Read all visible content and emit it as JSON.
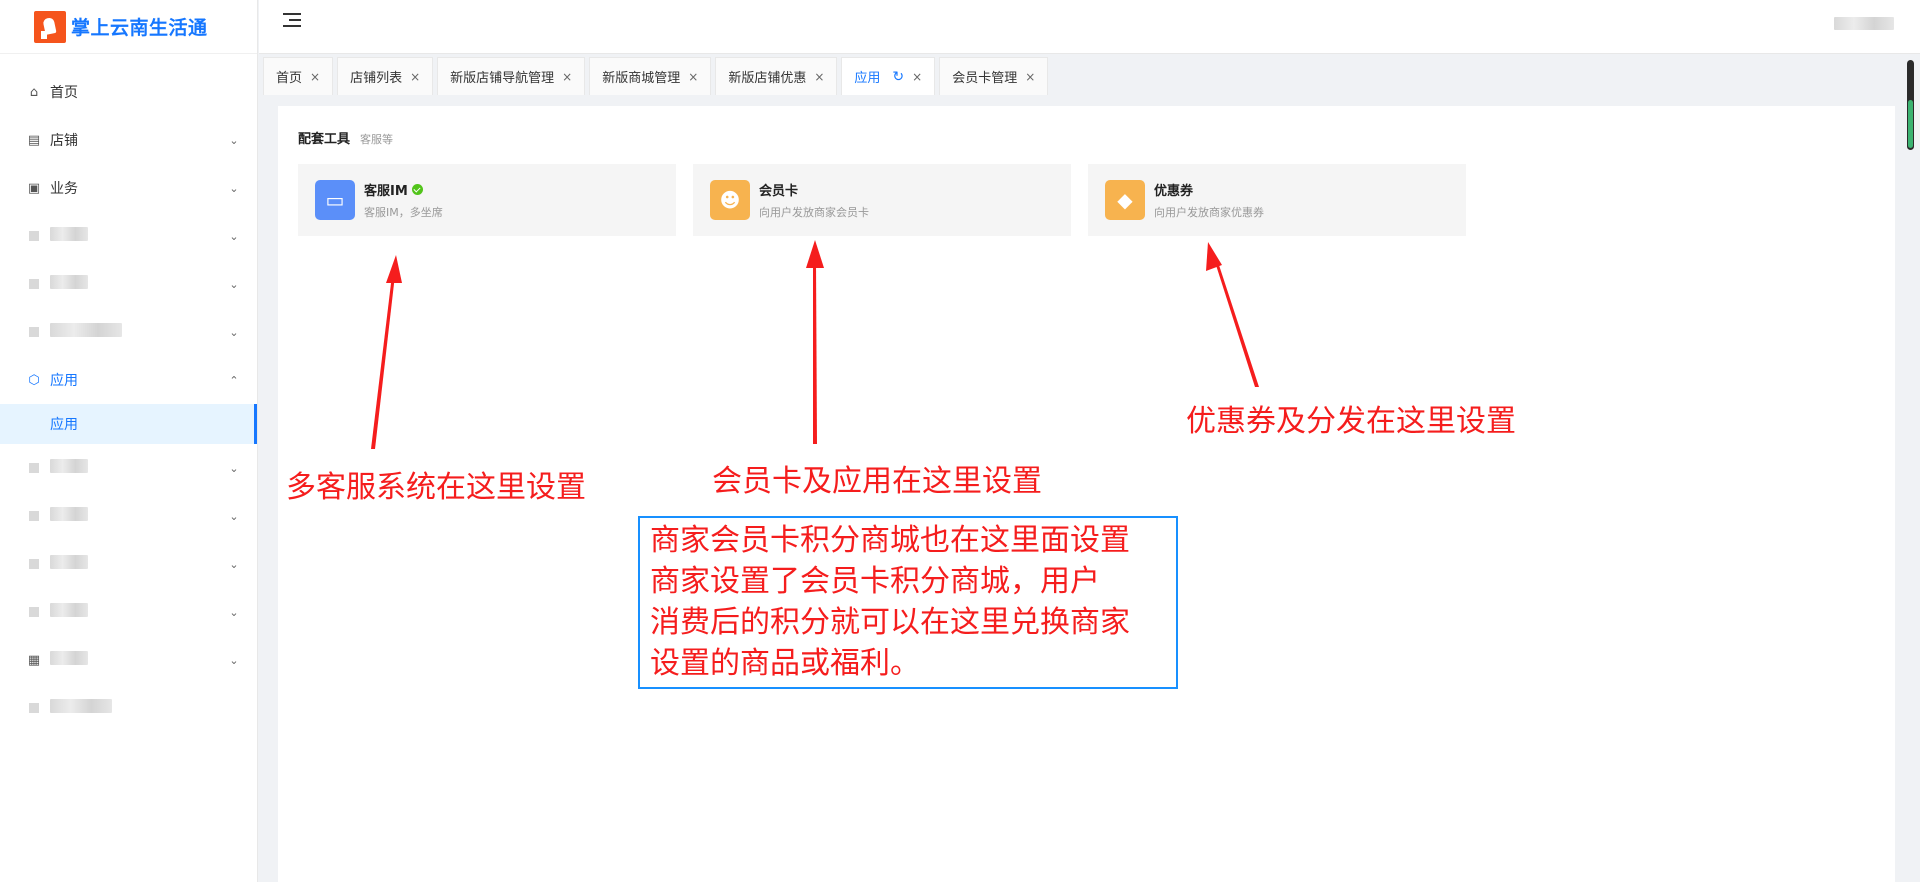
{
  "app": {
    "name": "掌上云南生活通"
  },
  "sidebar": {
    "items": [
      {
        "label": "首页",
        "icon": "home-icon",
        "arrow": ""
      },
      {
        "label": "店铺",
        "icon": "store-icon",
        "arrow": "⌄"
      },
      {
        "label": "业务",
        "icon": "briefcase-icon",
        "arrow": "⌄"
      },
      {
        "label": "",
        "icon": "blurred-icon",
        "arrow": "⌄",
        "blurred": true
      },
      {
        "label": "",
        "icon": "blurred-icon",
        "arrow": "⌄",
        "blurred": true
      },
      {
        "label": "",
        "icon": "blurred-icon",
        "arrow": "⌄",
        "blurred": true
      },
      {
        "label": "应用",
        "icon": "cube-icon",
        "arrow": "⌃",
        "active": true
      },
      {
        "label": "应用",
        "submenu": true
      },
      {
        "label": "",
        "icon": "blurred-icon",
        "arrow": "⌄",
        "blurred": true
      },
      {
        "label": "",
        "icon": "blurred-icon",
        "arrow": "⌄",
        "blurred": true
      },
      {
        "label": "",
        "icon": "blurred-icon",
        "arrow": "⌄",
        "blurred": true
      },
      {
        "label": "",
        "icon": "blurred-icon",
        "arrow": "⌄",
        "blurred": true
      },
      {
        "label": "",
        "icon": "grid-icon",
        "arrow": "⌄",
        "blurred": true
      },
      {
        "label": "",
        "icon": "blurred-icon",
        "arrow": "",
        "blurred": true
      }
    ]
  },
  "tabs": [
    {
      "label": "首页"
    },
    {
      "label": "店铺列表"
    },
    {
      "label": "新版店铺导航管理"
    },
    {
      "label": "新版商城管理"
    },
    {
      "label": "新版店铺优惠"
    },
    {
      "label": "应用",
      "active": true
    },
    {
      "label": "会员卡管理"
    }
  ],
  "content": {
    "section_title": "配套工具",
    "section_subtitle": "客服等",
    "tools": [
      {
        "title": "客服IM",
        "desc": "客服IM，多坐席",
        "icon": "chat-icon",
        "color": "#5b8ff9",
        "verified": true
      },
      {
        "title": "会员卡",
        "desc": "向用户发放商家会员卡",
        "icon": "member-icon",
        "color": "#f7b34f",
        "verified": false
      },
      {
        "title": "优惠券",
        "desc": "向用户发放商家优惠券",
        "icon": "coupon-icon",
        "color": "#f7b34f",
        "verified": false
      }
    ]
  },
  "annotations": {
    "im": "多客服系统在这里设置",
    "member": "会员卡及应用在这里设置",
    "coupon": "优惠券及分发在这里设置",
    "note_lines": [
      "商家会员卡积分商城也在这里面设置",
      "商家设置了会员卡积分商城，用户",
      "消费后的积分就可以在这里兑换商家",
      "设置的商品或福利。"
    ]
  },
  "colors": {
    "accent": "#1677ff",
    "annotation": "#f51d1d",
    "box": "#1890ff"
  }
}
